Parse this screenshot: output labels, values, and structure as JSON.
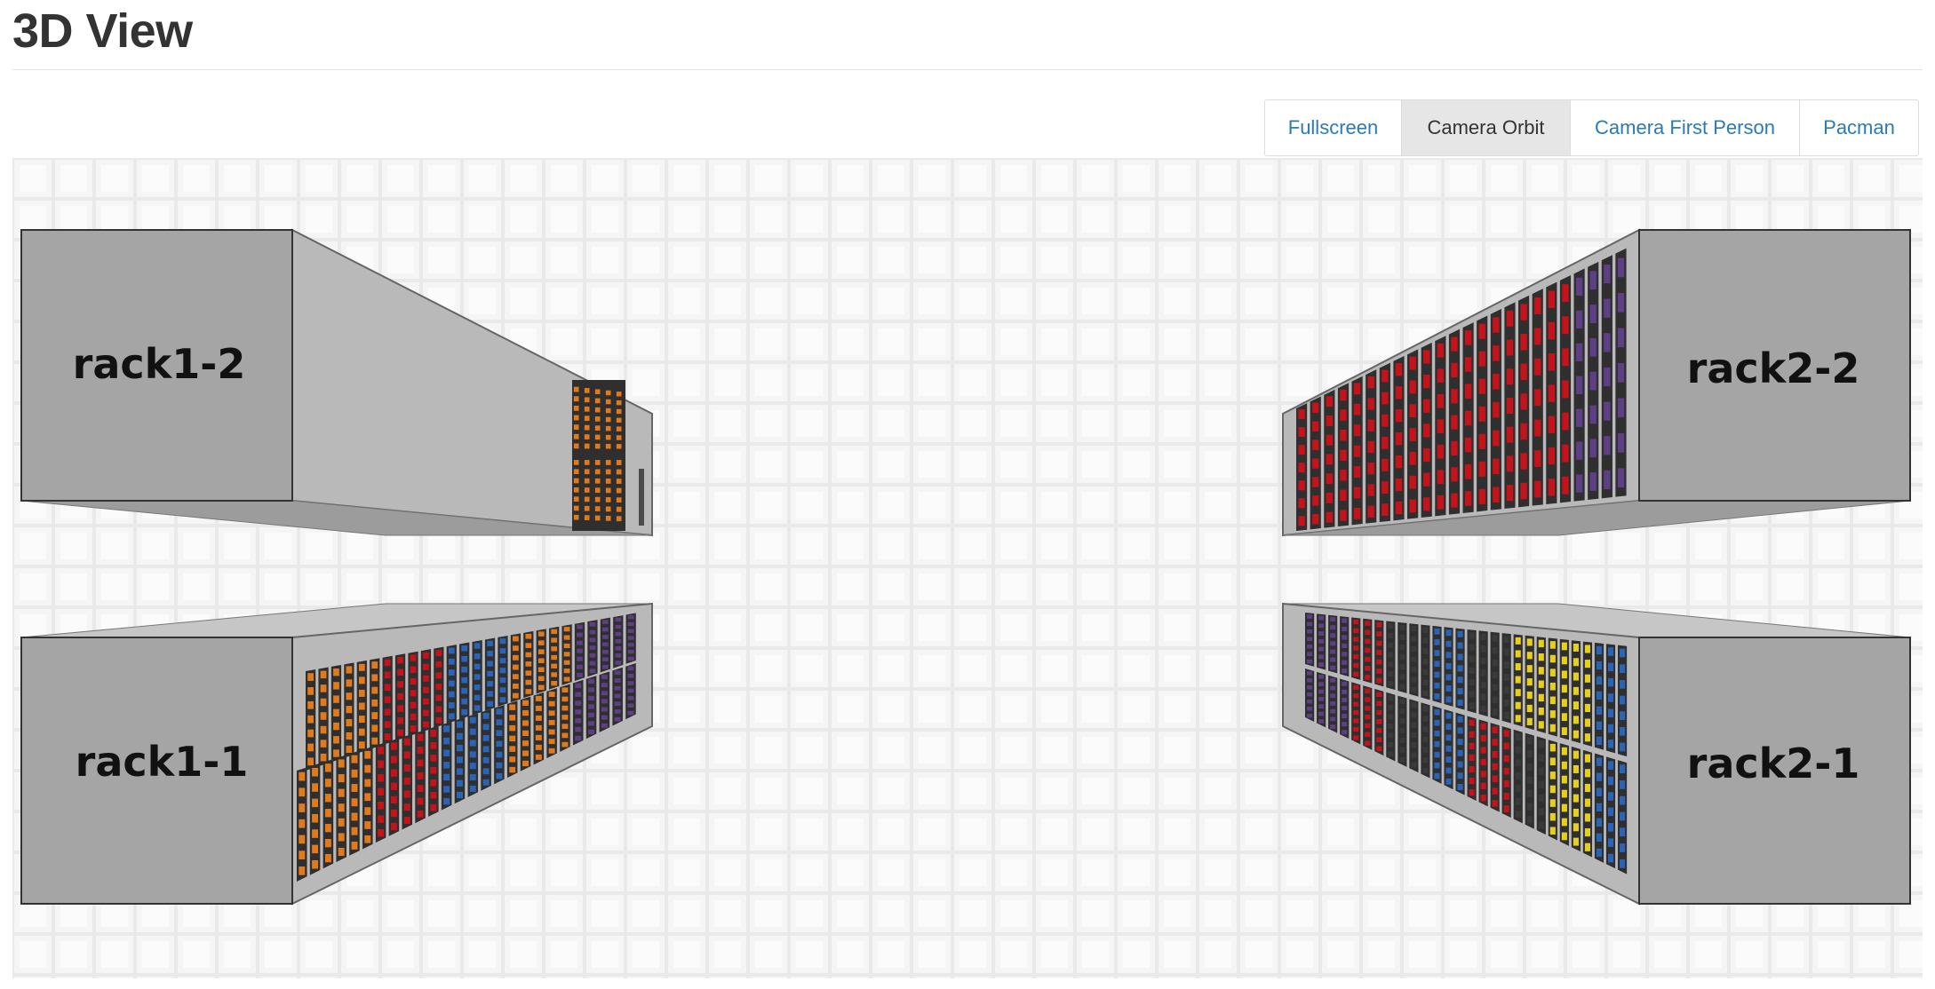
{
  "page": {
    "title": "3D View"
  },
  "toolbar": {
    "buttons": [
      {
        "id": "fullscreen",
        "label": "Fullscreen",
        "active": false
      },
      {
        "id": "camera-orbit",
        "label": "Camera Orbit",
        "active": true
      },
      {
        "id": "camera-first-person",
        "label": "Camera First Person",
        "active": false
      },
      {
        "id": "pacman",
        "label": "Pacman",
        "active": false
      }
    ]
  },
  "scene": {
    "racks": [
      {
        "id": "rack1-2",
        "label": "rack1-2"
      },
      {
        "id": "rack1-1",
        "label": "rack1-1"
      },
      {
        "id": "rack2-2",
        "label": "rack2-2"
      },
      {
        "id": "rack2-1",
        "label": "rack2-1"
      }
    ],
    "colors": {
      "floor": "#eeeeee",
      "rack_face": "#a5a5a5",
      "rack_side": "#b8b8b8",
      "server_orange": "#e07a1c",
      "server_red": "#c4131b",
      "server_blue": "#2a64b8",
      "server_purple": "#5e3f85",
      "server_yellow": "#e6cf1d",
      "server_dark": "#3a3a3a"
    }
  }
}
